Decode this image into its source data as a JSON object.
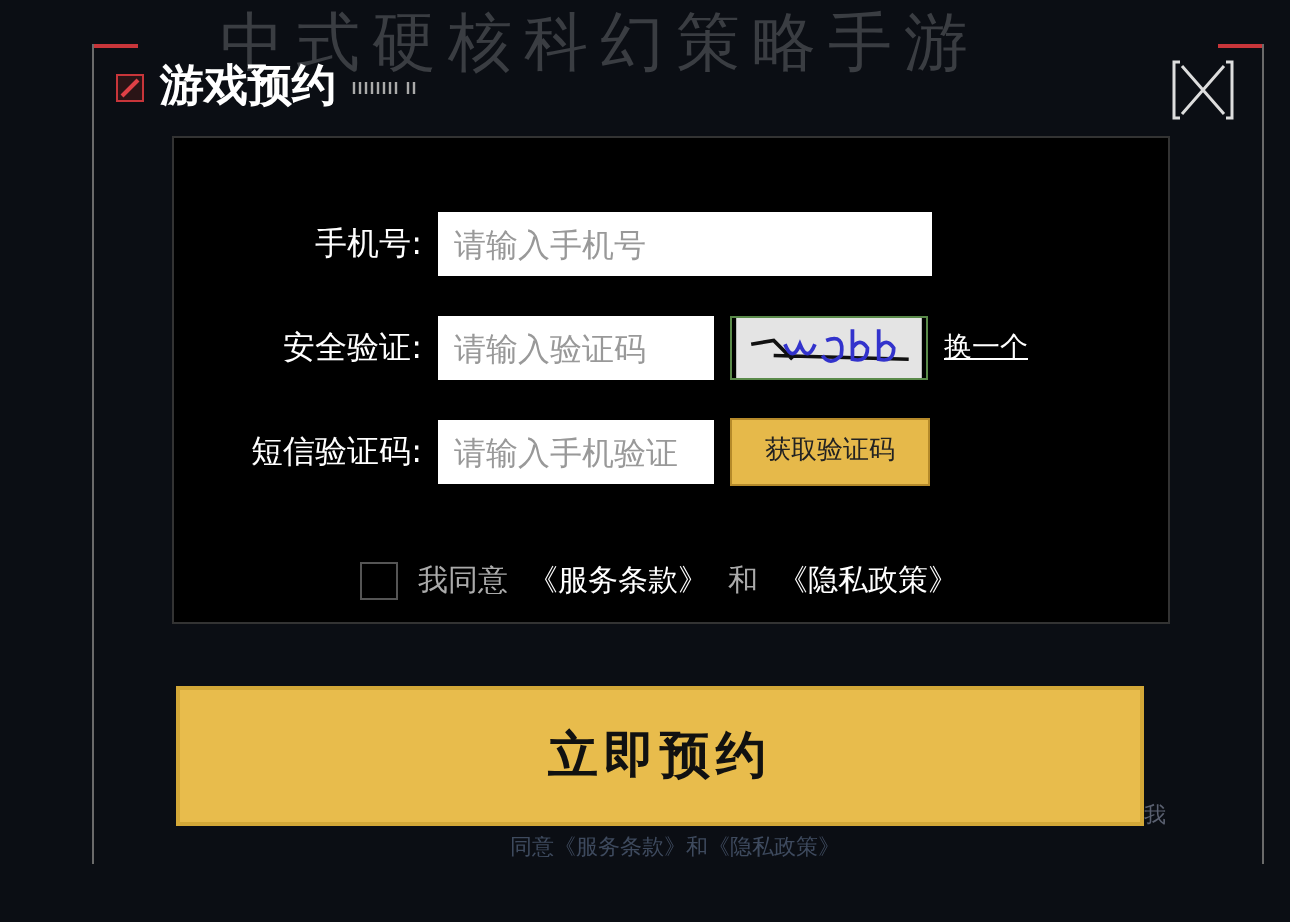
{
  "background": {
    "tagline": "中式硬核科幻策略手游",
    "side_word": "我",
    "footer_note": "同意《服务条款》和《隐私政策》"
  },
  "dialog": {
    "title": "游戏预约",
    "fields": [
      {
        "kind": "text",
        "label": "手机号:",
        "placeholder": "请输入手机号"
      },
      {
        "kind": "captcha",
        "label": "安全验证:",
        "placeholder": "请输入验证码",
        "action": "换一个"
      },
      {
        "kind": "sms",
        "label": "短信验证码:",
        "placeholder": "请输入手机验证",
        "action": "获取验证码"
      }
    ],
    "agreement": {
      "checked": false,
      "prefix": "我同意",
      "terms": "《服务条款》",
      "joiner": "和",
      "privacy": "《隐私政策》"
    },
    "submit": "立即预约"
  }
}
